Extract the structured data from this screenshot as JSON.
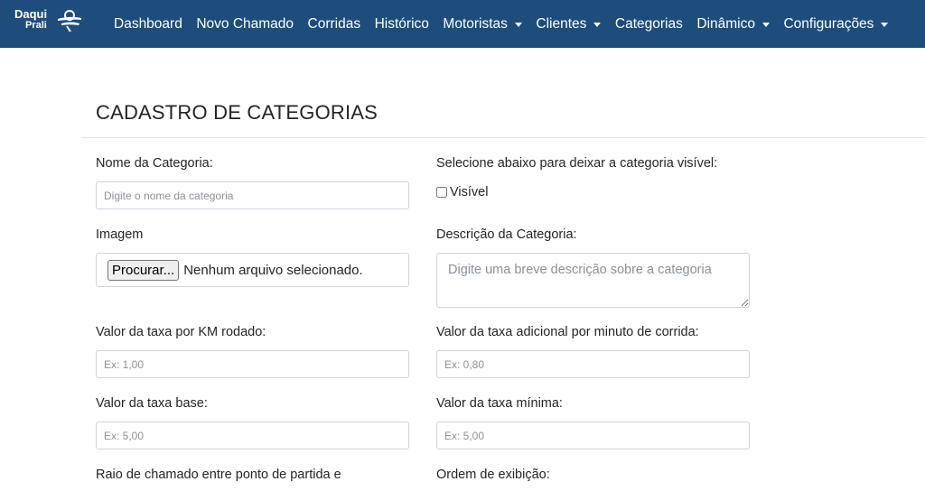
{
  "brand": {
    "line1": "Daqui",
    "line2": "Prali"
  },
  "nav": {
    "items": [
      {
        "label": "Dashboard",
        "dropdown": false
      },
      {
        "label": "Novo Chamado",
        "dropdown": false
      },
      {
        "label": "Corridas",
        "dropdown": false
      },
      {
        "label": "Histórico",
        "dropdown": false
      },
      {
        "label": "Motoristas",
        "dropdown": true
      },
      {
        "label": "Clientes",
        "dropdown": true
      },
      {
        "label": "Categorias",
        "dropdown": false
      },
      {
        "label": "Dinâmico",
        "dropdown": true
      },
      {
        "label": "Configurações",
        "dropdown": true
      }
    ]
  },
  "colors": {
    "navbar": "#1e4d7b",
    "nav_text": "#ffffff",
    "border": "#ced4da"
  },
  "form": {
    "title": "CADASTRO DE CATEGORIAS",
    "name_label": "Nome da Categoria:",
    "name_placeholder": "Digite o nome da categoria",
    "visible_label": "Selecione abaixo para deixar a categoria visível:",
    "visible_checkbox": "Visível",
    "visible_checked": false,
    "image_label": "Imagem",
    "file_button": "Procurar...",
    "file_status": "Nenhum arquivo selecionado.",
    "description_label": "Descrição da Categoria:",
    "description_placeholder": "Digite uma breve descrição sobre a categoria",
    "km_rate_label": "Valor da taxa por KM rodado:",
    "km_rate_placeholder": "Ex: 1,00",
    "minute_rate_label": "Valor da taxa adicional por minuto de corrida:",
    "minute_rate_placeholder": "Ex: 0,80",
    "base_rate_label": "Valor da taxa base:",
    "base_rate_placeholder": "Ex: 5,00",
    "min_rate_label": "Valor da taxa mínima:",
    "min_rate_placeholder": "Ex: 5,00",
    "radius_label": "Raio de chamado entre ponto de partida e",
    "order_label": "Ordem de exibição:"
  }
}
